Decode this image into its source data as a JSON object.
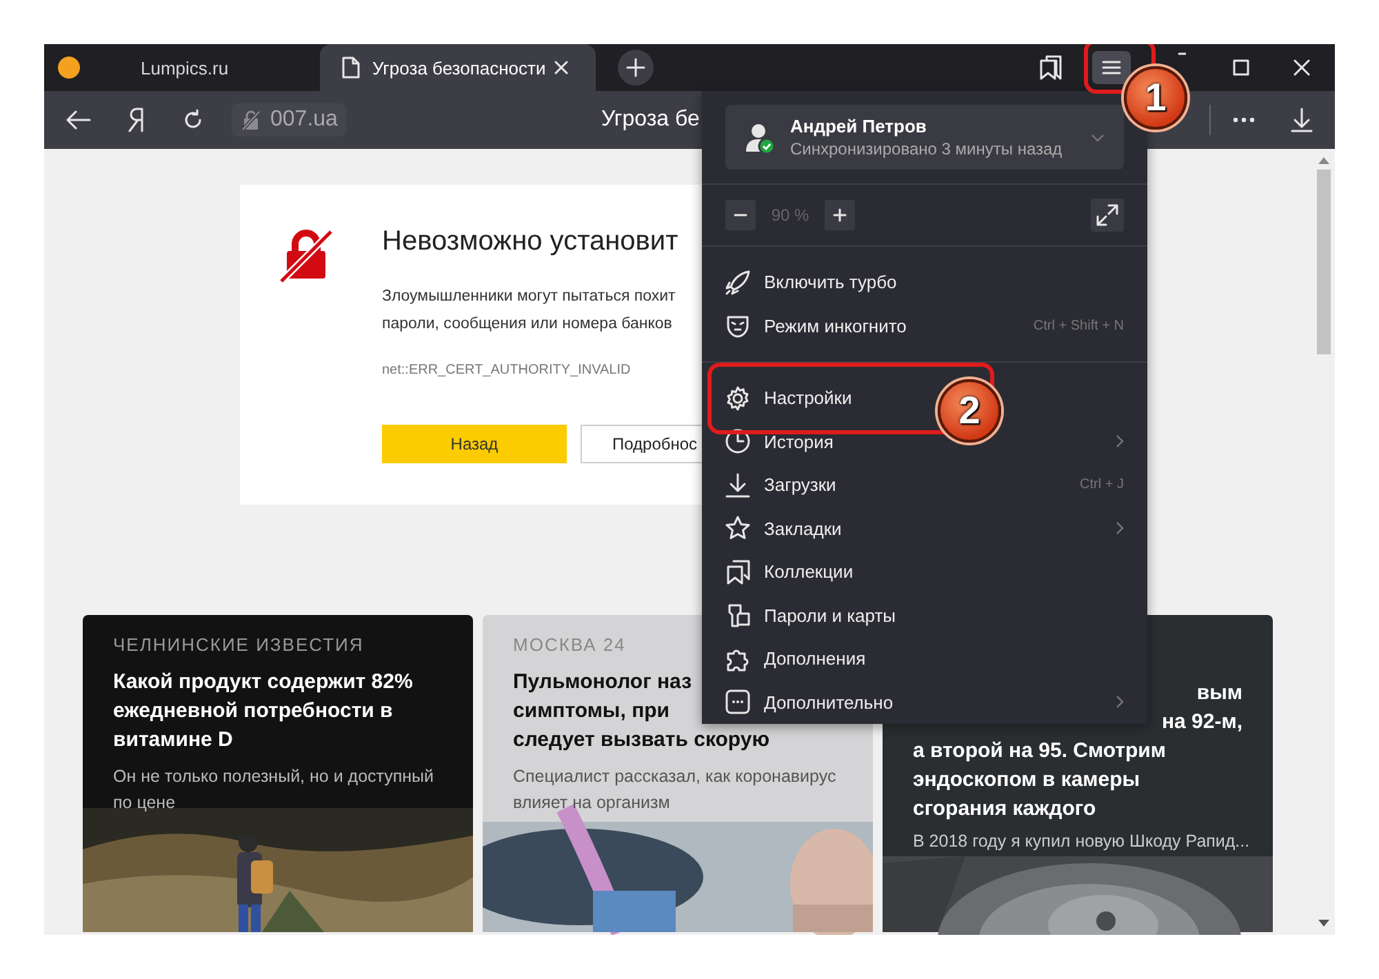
{
  "tabs": [
    {
      "label": "Lumpics.ru",
      "selected": false
    },
    {
      "label": "Угроза безопасности",
      "selected": true
    }
  ],
  "toolbar": {
    "menu_button_active": true,
    "address": "007.ua",
    "page_title": "Угроза бе"
  },
  "error_card": {
    "title": "Невозможно установит",
    "description_lines": [
      "Злоумышленники могут пытаться похит",
      "пароли, сообщения или номера банков"
    ],
    "error_code": "net::ERR_CERT_AUTHORITY_INVALID",
    "buttons": [
      {
        "label": "Назад",
        "kind": "primary"
      },
      {
        "label": "Подробнос",
        "kind": "secondary"
      }
    ]
  },
  "news_cards": [
    {
      "source": "ЧЕЛНИНСКИЕ ИЗВЕСТИЯ",
      "title_lines": [
        "Какой продукт содержит 82%",
        "ежедневной потребности в",
        "витамине D"
      ],
      "subtitle_lines": [
        "Он не только полезный, но и доступный",
        "по цене"
      ]
    },
    {
      "source": "МОСКВА 24",
      "title_lines": [
        "Пульмонолог наз",
        "симптомы, при",
        "следует вызвать скорую"
      ],
      "subtitle_lines": [
        "Специалист рассказал, как коронавирус",
        "влияет на организм"
      ]
    },
    {
      "title_tail_lines": [
        "вым",
        "на 92-м,"
      ],
      "title_lines": [
        "а второй на 95. Смотрим",
        "эндоскопом в камеры",
        "сгорания каждого"
      ],
      "subtitle_lines": [
        "В 2018 году я купил новую Шкоду Рапид..."
      ]
    }
  ],
  "menu": {
    "account": {
      "name": "Андрей Петров",
      "status": "Синхронизировано 3 минуты назад",
      "synced": true
    },
    "zoom": {
      "value": "90 %"
    },
    "sections": [
      [
        {
          "label": "Включить турбо",
          "submenu": false
        },
        {
          "label": "Режим инкогнито",
          "shortcut": "Ctrl + Shift + N",
          "submenu": false
        }
      ],
      [
        {
          "label": "Настройки",
          "submenu": false
        },
        {
          "label": "История",
          "submenu": true
        },
        {
          "label": "Загрузки",
          "shortcut": "Ctrl + J",
          "submenu": false
        },
        {
          "label": "Закладки",
          "submenu": true
        },
        {
          "label": "Коллекции",
          "submenu": false
        },
        {
          "label": "Пароли и карты",
          "submenu": false
        },
        {
          "label": "Дополнения",
          "submenu": false
        },
        {
          "label": "Дополнительно",
          "submenu": true
        }
      ]
    ]
  },
  "callouts": [
    {
      "number": "1"
    },
    {
      "number": "2"
    }
  ]
}
